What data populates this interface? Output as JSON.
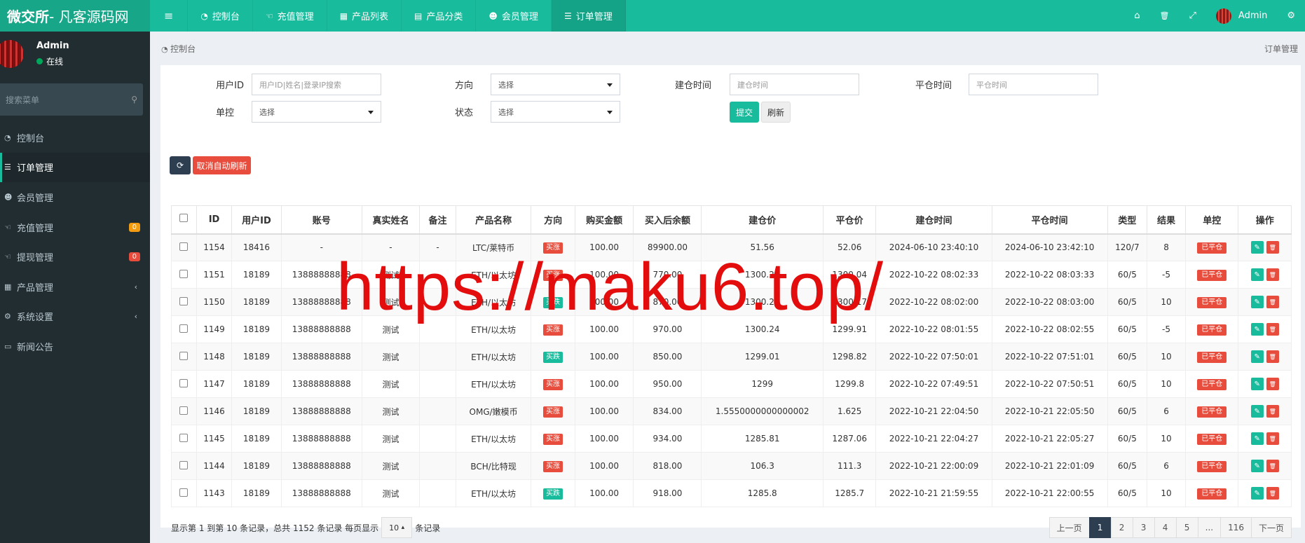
{
  "header": {
    "logo_bold": "微交所",
    "logo_rest": " - 凡客源码网",
    "toggle_icon": "≡",
    "tabs": [
      {
        "label": "控制台",
        "icon": "dashboard-icon",
        "glyph": "◔"
      },
      {
        "label": "充值管理",
        "icon": "hand-icon",
        "glyph": "☜"
      },
      {
        "label": "产品列表",
        "icon": "briefcase-icon",
        "glyph": "▦"
      },
      {
        "label": "产品分类",
        "icon": "list-icon",
        "glyph": "▤"
      },
      {
        "label": "会员管理",
        "icon": "users-icon",
        "glyph": "☻"
      },
      {
        "label": "订单管理",
        "icon": "list-ol-icon",
        "glyph": "☰"
      }
    ],
    "right": {
      "home_glyph": "⌂",
      "trash_glyph": "🗑",
      "expand_glyph": "⤢",
      "user": "Admin",
      "settings_glyph": "⚙"
    }
  },
  "sidebar": {
    "user": {
      "name": "Admin",
      "status": "在线",
      "status_color": "#00a65a"
    },
    "search_placeholder": "搜索菜单",
    "search_glyph": "⚲",
    "items": [
      {
        "label": "控制台",
        "glyph": "◔",
        "icon": "dashboard-icon"
      },
      {
        "label": "订单管理",
        "glyph": "☰",
        "icon": "list-ol-icon",
        "active": true
      },
      {
        "label": "会员管理",
        "glyph": "☻",
        "icon": "users-icon"
      },
      {
        "label": "充值管理",
        "glyph": "☜",
        "icon": "hand-icon",
        "badge": "0"
      },
      {
        "label": "提现管理",
        "glyph": "☜",
        "icon": "hand-icon",
        "badge": "0"
      },
      {
        "label": "产品管理",
        "glyph": "▦",
        "icon": "briefcase-icon",
        "chevron": "‹"
      },
      {
        "label": "系统设置",
        "glyph": "⚙",
        "icon": "cogs-icon",
        "chevron": "‹"
      },
      {
        "label": "新闻公告",
        "glyph": "▭",
        "icon": "newspaper-icon"
      }
    ]
  },
  "breadcrumb": {
    "left": "控制台",
    "right": "订单管理"
  },
  "filters": {
    "user_id": {
      "label": "用户ID",
      "placeholder": "用户ID|姓名|登录IP搜索"
    },
    "direction": {
      "label": "方向",
      "value": "选择"
    },
    "open_time": {
      "label": "建仓时间",
      "placeholder": "建仓时间"
    },
    "close_time": {
      "label": "平仓时间",
      "placeholder": "平仓时间"
    },
    "control": {
      "label": "单控",
      "value": "选择"
    },
    "status": {
      "label": "状态",
      "value": "选择"
    },
    "submit": "提交",
    "refresh": "刷新"
  },
  "toolbar": {
    "refresh_glyph": "⟳",
    "cancel_auto_refresh": "取消自动刷新"
  },
  "table": {
    "columns": [
      "",
      "ID",
      "用户ID",
      "账号",
      "真实姓名",
      "备注",
      "产品名称",
      "方向",
      "购买金额",
      "买入后余额",
      "建仓价",
      "平仓价",
      "建仓时间",
      "平仓时间",
      "类型",
      "结果",
      "单控",
      "操作"
    ],
    "rows": [
      {
        "id": "1154",
        "uid": "18416",
        "account": "-",
        "name": "-",
        "note": "-",
        "product": "LTC/莱特币",
        "dir": "买涨",
        "dir_type": "up",
        "amount": "100.00",
        "balance": "89900.00",
        "open": "51.56",
        "close": "52.06",
        "open_time": "2024-06-10 23:40:10",
        "close_time": "2024-06-10 23:42:10",
        "type": "120/7",
        "result": "8",
        "ctrl": "已平仓"
      },
      {
        "id": "1151",
        "uid": "18189",
        "account": "13888888888",
        "name": "测试",
        "note": "",
        "product": "ETH/以太坊",
        "dir": "买涨",
        "dir_type": "up",
        "amount": "100.00",
        "balance": "770.00",
        "open": "1300.25",
        "close": "1300.04",
        "open_time": "2022-10-22 08:02:33",
        "close_time": "2022-10-22 08:03:33",
        "type": "60/5",
        "result": "-5",
        "ctrl": "已平仓"
      },
      {
        "id": "1150",
        "uid": "18189",
        "account": "13888888888",
        "name": "测试",
        "note": "",
        "product": "ETH/以太坊",
        "dir": "买跌",
        "dir_type": "down",
        "amount": "100.00",
        "balance": "870.00",
        "open": "1300.25",
        "close": "1300.17",
        "open_time": "2022-10-22 08:02:00",
        "close_time": "2022-10-22 08:03:00",
        "type": "60/5",
        "result": "10",
        "ctrl": "已平仓"
      },
      {
        "id": "1149",
        "uid": "18189",
        "account": "13888888888",
        "name": "测试",
        "note": "",
        "product": "ETH/以太坊",
        "dir": "买涨",
        "dir_type": "up",
        "amount": "100.00",
        "balance": "970.00",
        "open": "1300.24",
        "close": "1299.91",
        "open_time": "2022-10-22 08:01:55",
        "close_time": "2022-10-22 08:02:55",
        "type": "60/5",
        "result": "-5",
        "ctrl": "已平仓"
      },
      {
        "id": "1148",
        "uid": "18189",
        "account": "13888888888",
        "name": "测试",
        "note": "",
        "product": "ETH/以太坊",
        "dir": "买跌",
        "dir_type": "down",
        "amount": "100.00",
        "balance": "850.00",
        "open": "1299.01",
        "close": "1298.82",
        "open_time": "2022-10-22 07:50:01",
        "close_time": "2022-10-22 07:51:01",
        "type": "60/5",
        "result": "10",
        "ctrl": "已平仓"
      },
      {
        "id": "1147",
        "uid": "18189",
        "account": "13888888888",
        "name": "测试",
        "note": "",
        "product": "ETH/以太坊",
        "dir": "买涨",
        "dir_type": "up",
        "amount": "100.00",
        "balance": "950.00",
        "open": "1299",
        "close": "1299.8",
        "open_time": "2022-10-22 07:49:51",
        "close_time": "2022-10-22 07:50:51",
        "type": "60/5",
        "result": "10",
        "ctrl": "已平仓"
      },
      {
        "id": "1146",
        "uid": "18189",
        "account": "13888888888",
        "name": "测试",
        "note": "",
        "product": "OMG/嫩模币",
        "dir": "买涨",
        "dir_type": "up",
        "amount": "100.00",
        "balance": "834.00",
        "open": "1.5550000000000002",
        "close": "1.625",
        "open_time": "2022-10-21 22:04:50",
        "close_time": "2022-10-21 22:05:50",
        "type": "60/5",
        "result": "6",
        "ctrl": "已平仓"
      },
      {
        "id": "1145",
        "uid": "18189",
        "account": "13888888888",
        "name": "测试",
        "note": "",
        "product": "ETH/以太坊",
        "dir": "买涨",
        "dir_type": "up",
        "amount": "100.00",
        "balance": "934.00",
        "open": "1285.81",
        "close": "1287.06",
        "open_time": "2022-10-21 22:04:27",
        "close_time": "2022-10-21 22:05:27",
        "type": "60/5",
        "result": "10",
        "ctrl": "已平仓"
      },
      {
        "id": "1144",
        "uid": "18189",
        "account": "13888888888",
        "name": "测试",
        "note": "",
        "product": "BCH/比特现",
        "dir": "买涨",
        "dir_type": "up",
        "amount": "100.00",
        "balance": "818.00",
        "open": "106.3",
        "close": "111.3",
        "open_time": "2022-10-21 22:00:09",
        "close_time": "2022-10-21 22:01:09",
        "type": "60/5",
        "result": "6",
        "ctrl": "已平仓"
      },
      {
        "id": "1143",
        "uid": "18189",
        "account": "13888888888",
        "name": "测试",
        "note": "",
        "product": "ETH/以太坊",
        "dir": "买跌",
        "dir_type": "down",
        "amount": "100.00",
        "balance": "918.00",
        "open": "1285.8",
        "close": "1285.7",
        "open_time": "2022-10-21 21:59:55",
        "close_time": "2022-10-21 22:00:55",
        "type": "60/5",
        "result": "10",
        "ctrl": "已平仓"
      }
    ]
  },
  "footer": {
    "info_prefix": "显示第 1 到第 10 条记录，总共 1152 条记录 每页显示",
    "page_size": "10",
    "page_size_caret": "▴",
    "info_suffix": "条记录",
    "pager": [
      "上一页",
      "1",
      "2",
      "3",
      "4",
      "5",
      "...",
      "116",
      "下一页"
    ],
    "active_page": "1"
  },
  "watermark": "https://maku6.top/",
  "colors": {
    "primary": "#18bc9c",
    "danger": "#e74c3c",
    "sidebar": "#222d32",
    "dark": "#2c3e50"
  }
}
